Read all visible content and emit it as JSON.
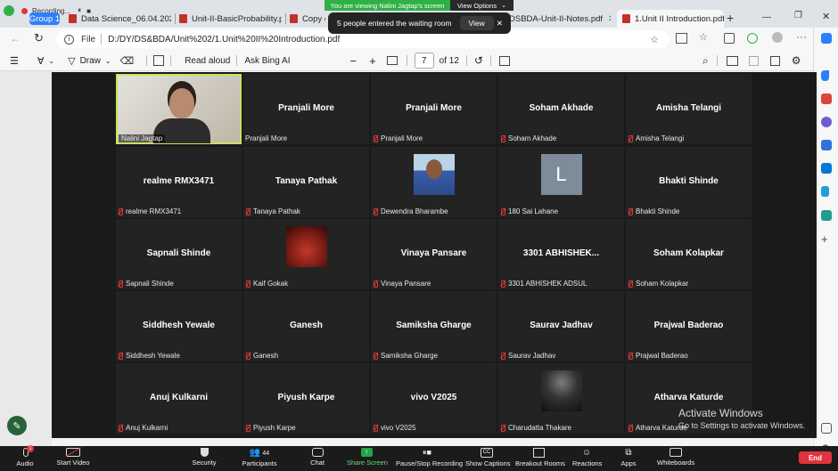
{
  "recording": {
    "label": "Recording...",
    "pause": "⏸",
    "stop": "■"
  },
  "tabs": [
    {
      "label": "Group 1",
      "type": "group"
    },
    {
      "label": "Data Science_06.04.2021.p"
    },
    {
      "label": "Unit-II-BasicProbability.p"
    },
    {
      "label": "Copy of"
    },
    {
      "label": "DSBDA-Unit-II-Notes.pdf"
    },
    {
      "label": "1.Unit II Introduction.pdf",
      "active": true
    }
  ],
  "banner": {
    "viewing": "You are viewing Nalini Jagtap's screen",
    "options": "View Options"
  },
  "toast": {
    "text": "5 people entered the waiting room",
    "view": "View"
  },
  "address": {
    "prefix": "File",
    "url": "D:/DY/DS&BDA/Unit%202/1.Unit%20II%20Introduction.pdf"
  },
  "pdf_toolbar": {
    "draw": "Draw",
    "read_aloud": "Read aloud",
    "ask_bing": "Ask Bing AI",
    "page": "7",
    "of_pages": "of 12"
  },
  "participants": [
    {
      "name": "",
      "label": "Nalini Jagtap",
      "video": true,
      "active": true,
      "muted": false
    },
    {
      "name": "Pranjali More",
      "label": "Pranjali More",
      "muted": false
    },
    {
      "name": "Pranjali More",
      "label": "Pranjali More",
      "muted": true
    },
    {
      "name": "Soham Akhade",
      "label": "Soham Akhade",
      "muted": true
    },
    {
      "name": "Amisha Telangi",
      "label": "Amisha Telangi",
      "muted": true
    },
    {
      "name": "realme RMX3471",
      "label": "realme RMX3471",
      "muted": true
    },
    {
      "name": "Tanaya Pathak",
      "label": "Tanaya Pathak",
      "muted": true
    },
    {
      "name": "",
      "label": "Dewendra Bharambe",
      "photo": "man",
      "muted": true
    },
    {
      "name": "",
      "label": "180 Sai Lahane",
      "photo": "L",
      "muted": true
    },
    {
      "name": "Bhakti Shinde",
      "label": "Bhakti Shinde",
      "muted": true
    },
    {
      "name": "Sapnali Shinde",
      "label": "Sapnali Shinde",
      "muted": true
    },
    {
      "name": "",
      "label": "Kaif Gokak",
      "photo": "red",
      "muted": true
    },
    {
      "name": "Vinaya Pansare",
      "label": "Vinaya Pansare",
      "muted": true
    },
    {
      "name": "3301  ABHISHEK...",
      "label": "3301 ABHISHEK ADSUL",
      "muted": true
    },
    {
      "name": "Soham Kolapkar",
      "label": "Soham Kolapkar",
      "muted": true
    },
    {
      "name": "Siddhesh Yewale",
      "label": "Siddhesh Yewale",
      "muted": true
    },
    {
      "name": "Ganesh",
      "label": "Ganesh",
      "muted": true
    },
    {
      "name": "Samiksha Gharge",
      "label": "Samiksha Gharge",
      "muted": true
    },
    {
      "name": "Saurav Jadhav",
      "label": "Saurav Jadhav",
      "muted": true
    },
    {
      "name": "Prajwal Baderao",
      "label": "Prajwal Baderao",
      "muted": true
    },
    {
      "name": "Anuj Kulkarni",
      "label": "Anuj Kulkarni",
      "muted": true
    },
    {
      "name": "Piyush Karpe",
      "label": "Piyush Karpe",
      "muted": true
    },
    {
      "name": "vivo V2025",
      "label": "vivo V2025",
      "muted": true
    },
    {
      "name": "",
      "label": "Charudatta Thakare",
      "photo": "dark",
      "muted": true
    },
    {
      "name": "Atharva Katurde",
      "label": "Atharva Katurde",
      "muted": true
    }
  ],
  "zoom_toolbar": {
    "audio": "Audio",
    "start_video": "Start Video",
    "security": "Security",
    "participants": "Participants",
    "participant_count": "44",
    "chat": "Chat",
    "share_screen": "Share Screen",
    "pause_recording": "Pause/Stop Recording",
    "captions": "Show Captions",
    "breakout": "Breakout Rooms",
    "reactions": "Reactions",
    "apps": "Apps",
    "whiteboards": "Whiteboards",
    "end": "End"
  },
  "watermark": {
    "title": "Activate Windows",
    "sub": "Go to Settings to activate Windows."
  },
  "colors": {
    "zoom_bg": "#1a1a1a",
    "active_border": "#c7e35a",
    "banner_green": "#2fb146",
    "end_red": "#e0333e",
    "share_green": "#22a447"
  }
}
